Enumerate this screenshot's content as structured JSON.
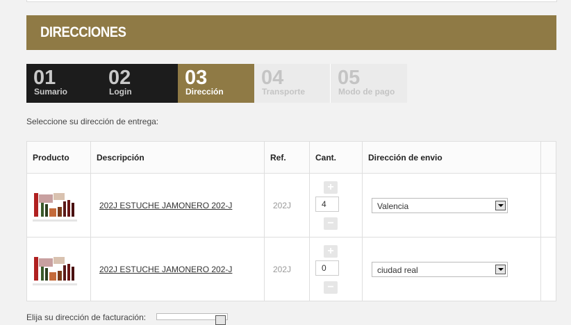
{
  "page_title": "DIRECCIONES",
  "steps": [
    {
      "num": "01",
      "label": "Sumario"
    },
    {
      "num": "02",
      "label": "Login"
    },
    {
      "num": "03",
      "label": "Dirección"
    },
    {
      "num": "04",
      "label": "Transporte"
    },
    {
      "num": "05",
      "label": "Modo de pago"
    }
  ],
  "instruction": "Seleccione su dirección de entrega:",
  "table": {
    "headers": [
      "Producto",
      "Descripción",
      "Ref.",
      "Cant.",
      "Dirección de envio",
      ""
    ],
    "rows": [
      {
        "description": "202J ESTUCHE JAMONERO 202-J",
        "ref": "202J",
        "quantity": "4",
        "address": "Valencia",
        "plus": "+",
        "minus": "−"
      },
      {
        "description": "202J ESTUCHE JAMONERO 202-J",
        "ref": "202J",
        "quantity": "0",
        "address": "ciudad real",
        "plus": "+",
        "minus": "−"
      }
    ]
  },
  "billing_label": "Elija su dirección de facturación:"
}
